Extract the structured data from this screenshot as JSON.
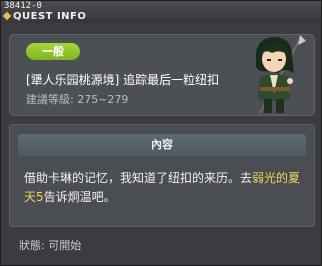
{
  "window": {
    "id": "38412-0",
    "title": "QUEST INFO"
  },
  "quest": {
    "category": "一般",
    "name": "[犟人乐园桃源境] 追踪最后一粒纽扣",
    "level": "建議等級: 275~279"
  },
  "content": {
    "header": "內容",
    "description_part1": "借助卡琳的记忆，我知道了纽扣的来历。去",
    "description_highlight": "弱光的夏天5",
    "description_part2": "告诉炯温吧。"
  },
  "status": {
    "text": "狀態:  可開始"
  },
  "colors": {
    "badge": "#8cc42c",
    "highlight": "#f0d85a"
  }
}
